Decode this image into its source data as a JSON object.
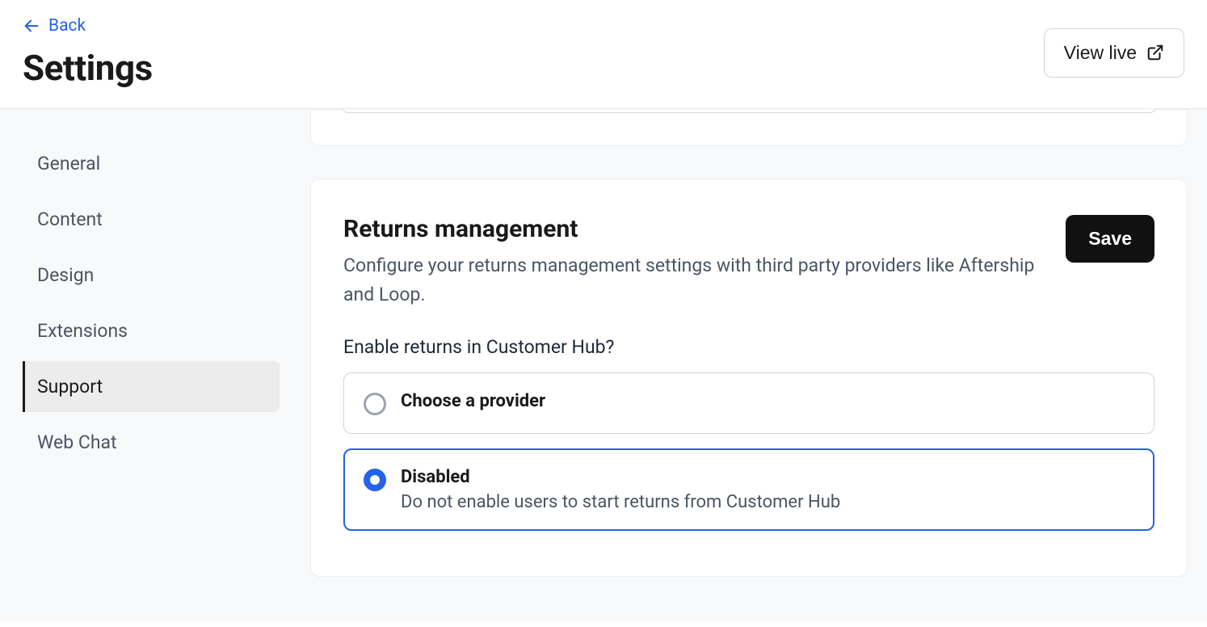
{
  "header": {
    "back_label": "Back",
    "title": "Settings",
    "view_live_label": "View live"
  },
  "sidebar": {
    "items": [
      {
        "label": "General",
        "active": false
      },
      {
        "label": "Content",
        "active": false
      },
      {
        "label": "Design",
        "active": false
      },
      {
        "label": "Extensions",
        "active": false
      },
      {
        "label": "Support",
        "active": true
      },
      {
        "label": "Web Chat",
        "active": false
      }
    ]
  },
  "main": {
    "card": {
      "title": "Returns management",
      "description": "Configure your returns management settings with third party providers like Aftership and Loop.",
      "save_label": "Save",
      "field_label": "Enable returns in Customer Hub?",
      "options": [
        {
          "title": "Choose a provider",
          "description": "",
          "selected": false
        },
        {
          "title": "Disabled",
          "description": "Do not enable users to start returns from Customer Hub",
          "selected": true
        }
      ]
    }
  }
}
